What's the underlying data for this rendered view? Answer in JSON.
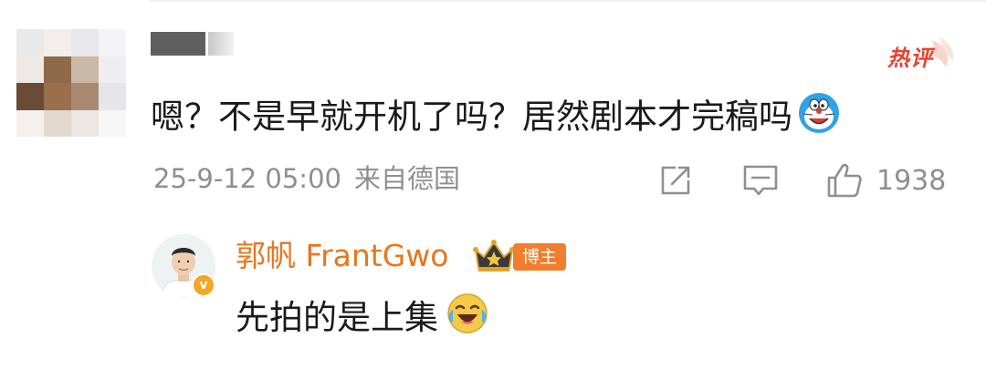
{
  "comment": {
    "hot_label": "热评",
    "text": "嗯？不是早就开机了吗？居然剧本才完稿吗",
    "emoji": "doraemon-emoji",
    "timestamp": "25-9-12 05:00",
    "location": "来自德国",
    "like_count": "1938"
  },
  "reply": {
    "author": "郭帆 FrantGwo",
    "author_badge": "博主",
    "text": "先拍的是上集",
    "emoji": "laughing-crying-emoji"
  },
  "colors": {
    "accent": "#e8761e",
    "hot": "#e8402f",
    "meta": "#8f8f8f",
    "text": "#1a1a1a"
  }
}
